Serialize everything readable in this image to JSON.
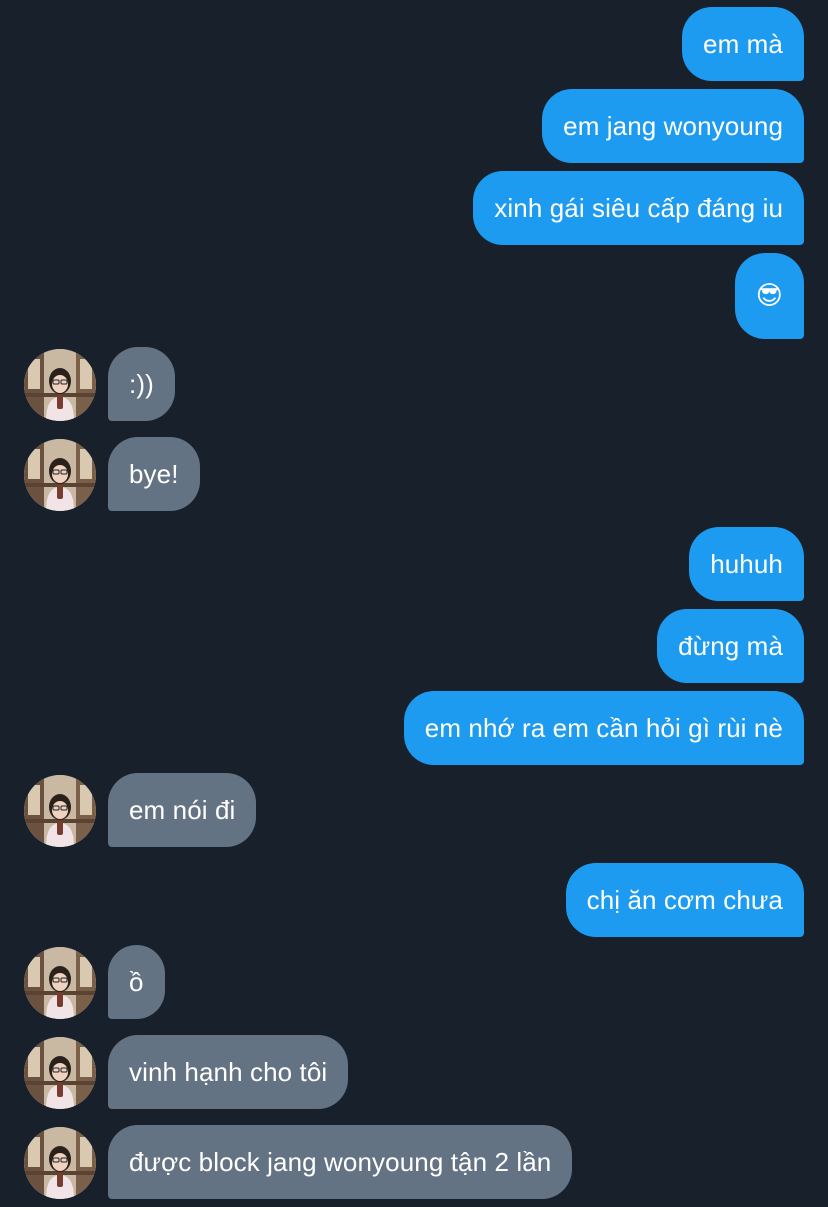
{
  "colors": {
    "background": "#17202b",
    "sent_bubble": "#1d9bf0",
    "received_bubble": "#647384",
    "text": "#ffffff"
  },
  "contact": {
    "avatar_icon": "user-avatar-photo-icon"
  },
  "messages": [
    {
      "direction": "sent",
      "text": "em mà"
    },
    {
      "direction": "sent",
      "text": "em jang wonyoung"
    },
    {
      "direction": "sent",
      "text": "xinh gái siêu cấp đáng iu"
    },
    {
      "direction": "sent",
      "text": "😎"
    },
    {
      "direction": "received",
      "text": ":))"
    },
    {
      "direction": "received",
      "text": "bye!"
    },
    {
      "direction": "sent",
      "text": "huhuh"
    },
    {
      "direction": "sent",
      "text": "đừng mà"
    },
    {
      "direction": "sent",
      "text": "em nhớ ra em cần hỏi gì rùi nè"
    },
    {
      "direction": "received",
      "text": "em nói đi"
    },
    {
      "direction": "sent",
      "text": "chị ăn cơm chưa"
    },
    {
      "direction": "received",
      "text": "ồ"
    },
    {
      "direction": "received",
      "text": "vinh hạnh cho tôi"
    },
    {
      "direction": "received",
      "text": "được block jang wonyoung tận 2 lần"
    }
  ]
}
